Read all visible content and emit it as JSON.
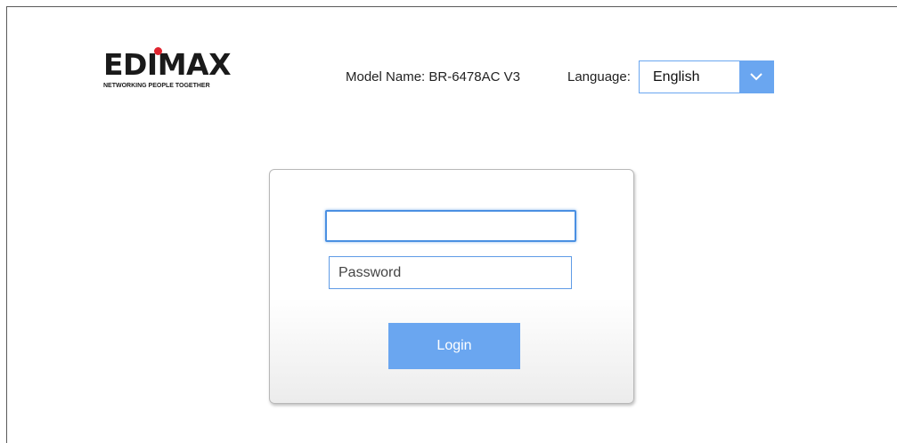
{
  "brand": {
    "wordmark": "EDIMAX",
    "tagline": "NETWORKING PEOPLE TOGETHER"
  },
  "header": {
    "model_text": "Model Name: BR-6478AC V3",
    "language_label": "Language:",
    "language_selected": "English"
  },
  "login_form": {
    "username_value": "",
    "password_placeholder": "Password",
    "login_label": "Login"
  },
  "colors": {
    "accent": "#6aa6f0",
    "focus_border": "#4a90e2",
    "logo_dot": "#e0242f"
  }
}
